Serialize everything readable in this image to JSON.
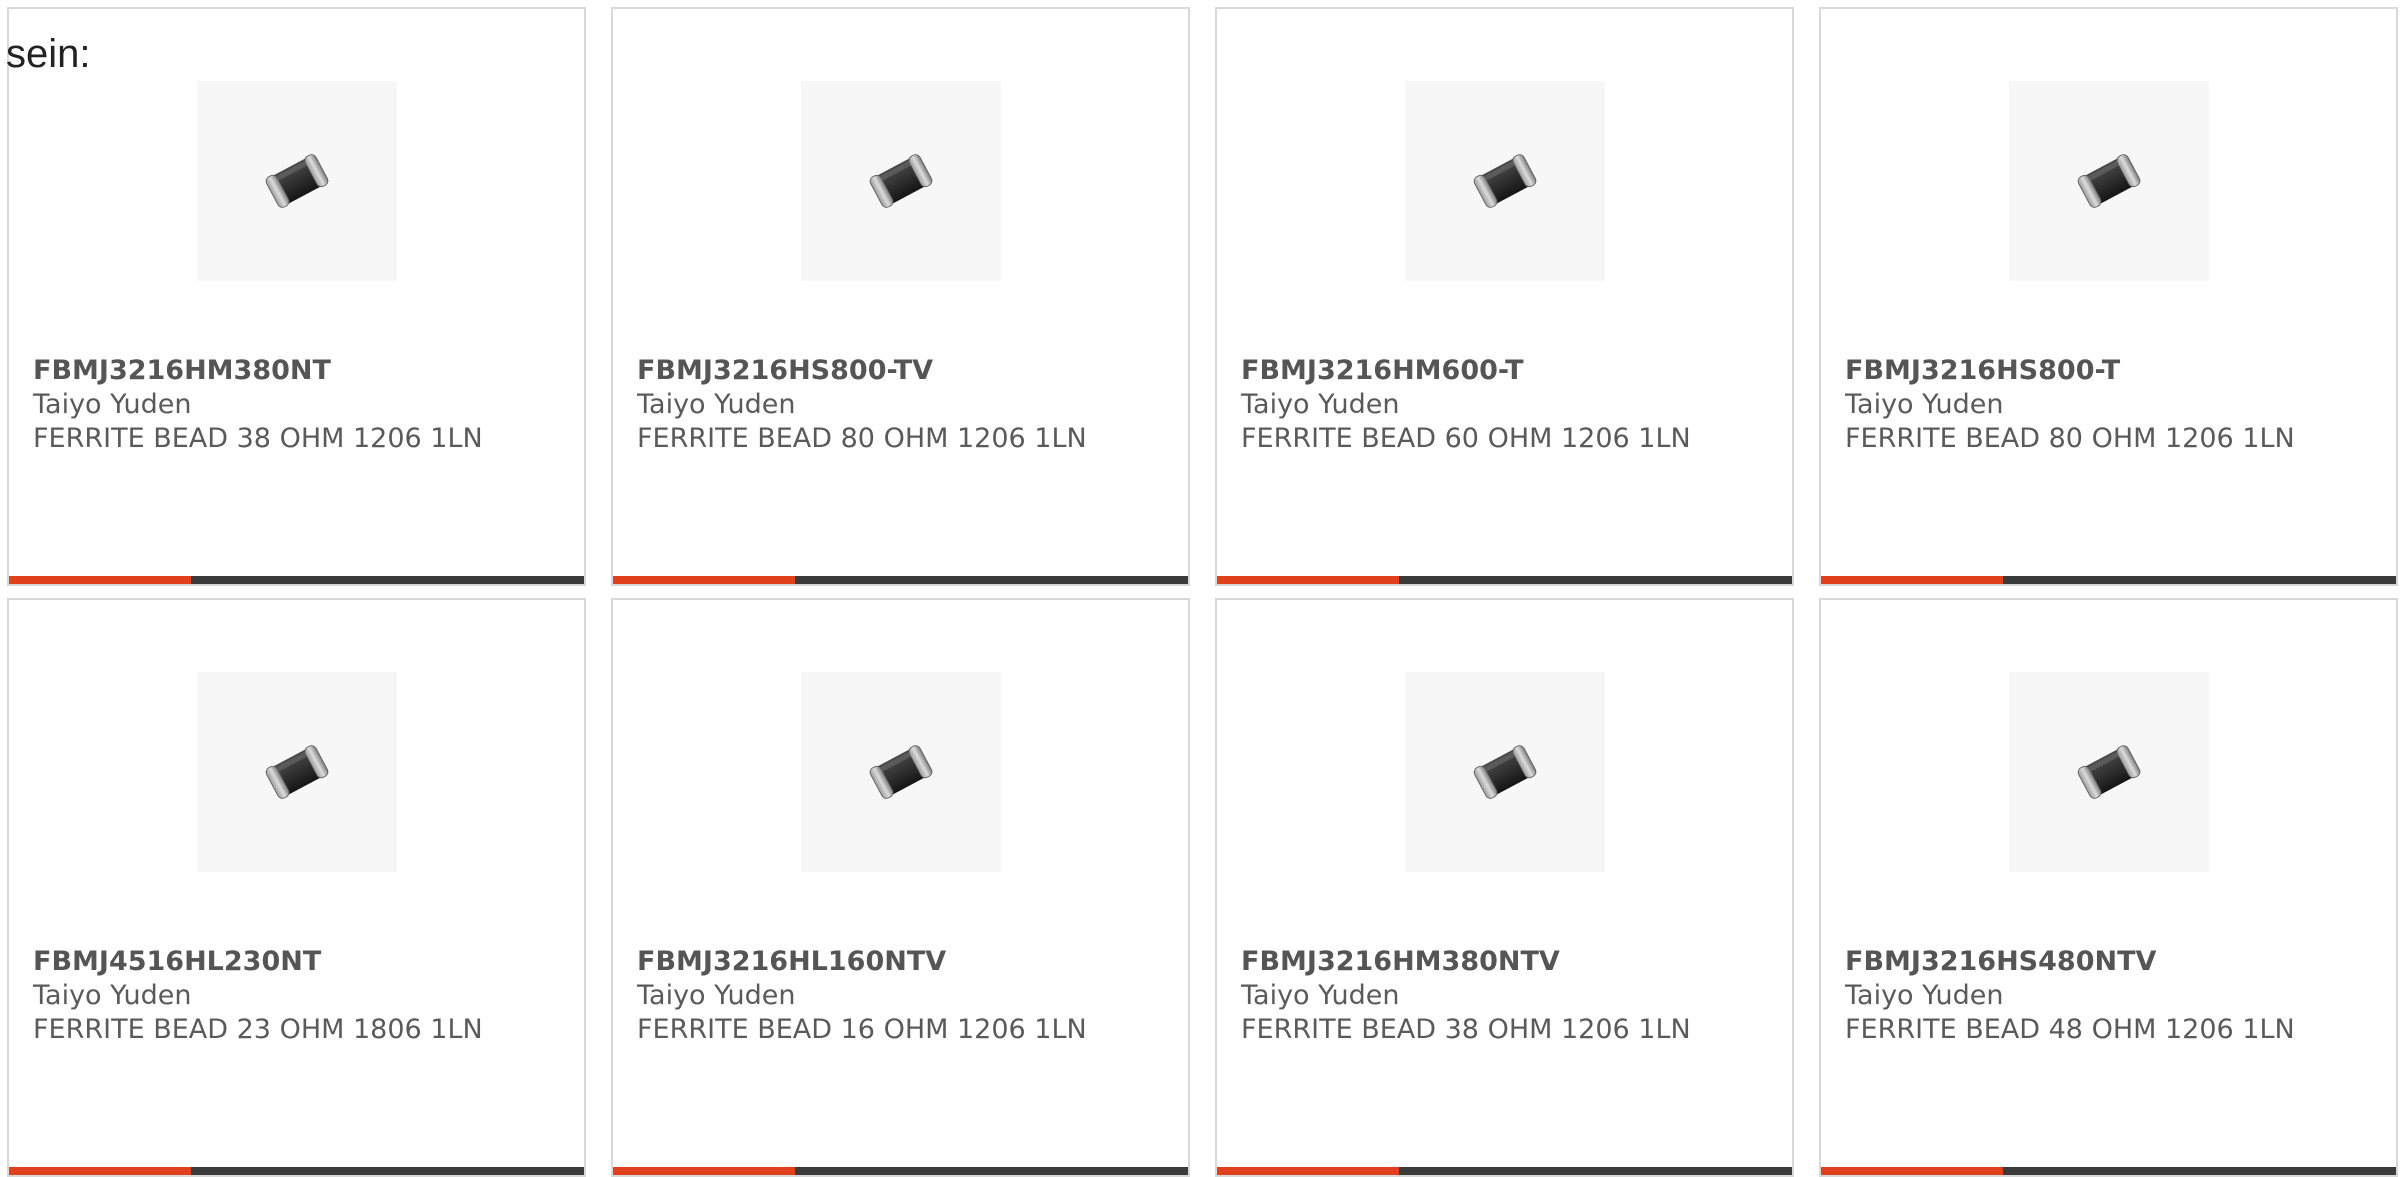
{
  "intro_text": "sein:",
  "colors": {
    "accent": "#e0401c",
    "bar": "#3a3a3a",
    "border": "#d8d8d8",
    "text": "#5a5a5a"
  },
  "products": [
    {
      "part": "FBMJ3216HM380NT",
      "maker": "Taiyo Yuden",
      "desc": "FERRITE BEAD 38 OHM 1206 1LN",
      "image_icon": "ferrite-bead-chip-icon"
    },
    {
      "part": "FBMJ3216HS800-TV",
      "maker": "Taiyo Yuden",
      "desc": "FERRITE BEAD 80 OHM 1206 1LN",
      "image_icon": "ferrite-bead-chip-icon"
    },
    {
      "part": "FBMJ3216HM600-T",
      "maker": "Taiyo Yuden",
      "desc": "FERRITE BEAD 60 OHM 1206 1LN",
      "image_icon": "ferrite-bead-chip-icon"
    },
    {
      "part": "FBMJ3216HS800-T",
      "maker": "Taiyo Yuden",
      "desc": "FERRITE BEAD 80 OHM 1206 1LN",
      "image_icon": "ferrite-bead-chip-icon"
    },
    {
      "part": "FBMJ4516HL230NT",
      "maker": "Taiyo Yuden",
      "desc": "FERRITE BEAD 23 OHM 1806 1LN",
      "image_icon": "ferrite-bead-chip-icon"
    },
    {
      "part": "FBMJ3216HL160NTV",
      "maker": "Taiyo Yuden",
      "desc": "FERRITE BEAD 16 OHM 1206 1LN",
      "image_icon": "ferrite-bead-chip-icon"
    },
    {
      "part": "FBMJ3216HM380NTV",
      "maker": "Taiyo Yuden",
      "desc": "FERRITE BEAD 38 OHM 1206 1LN",
      "image_icon": "ferrite-bead-chip-icon"
    },
    {
      "part": "FBMJ3216HS480NTV",
      "maker": "Taiyo Yuden",
      "desc": "FERRITE BEAD 48 OHM 1206 1LN",
      "image_icon": "ferrite-bead-chip-icon"
    }
  ]
}
